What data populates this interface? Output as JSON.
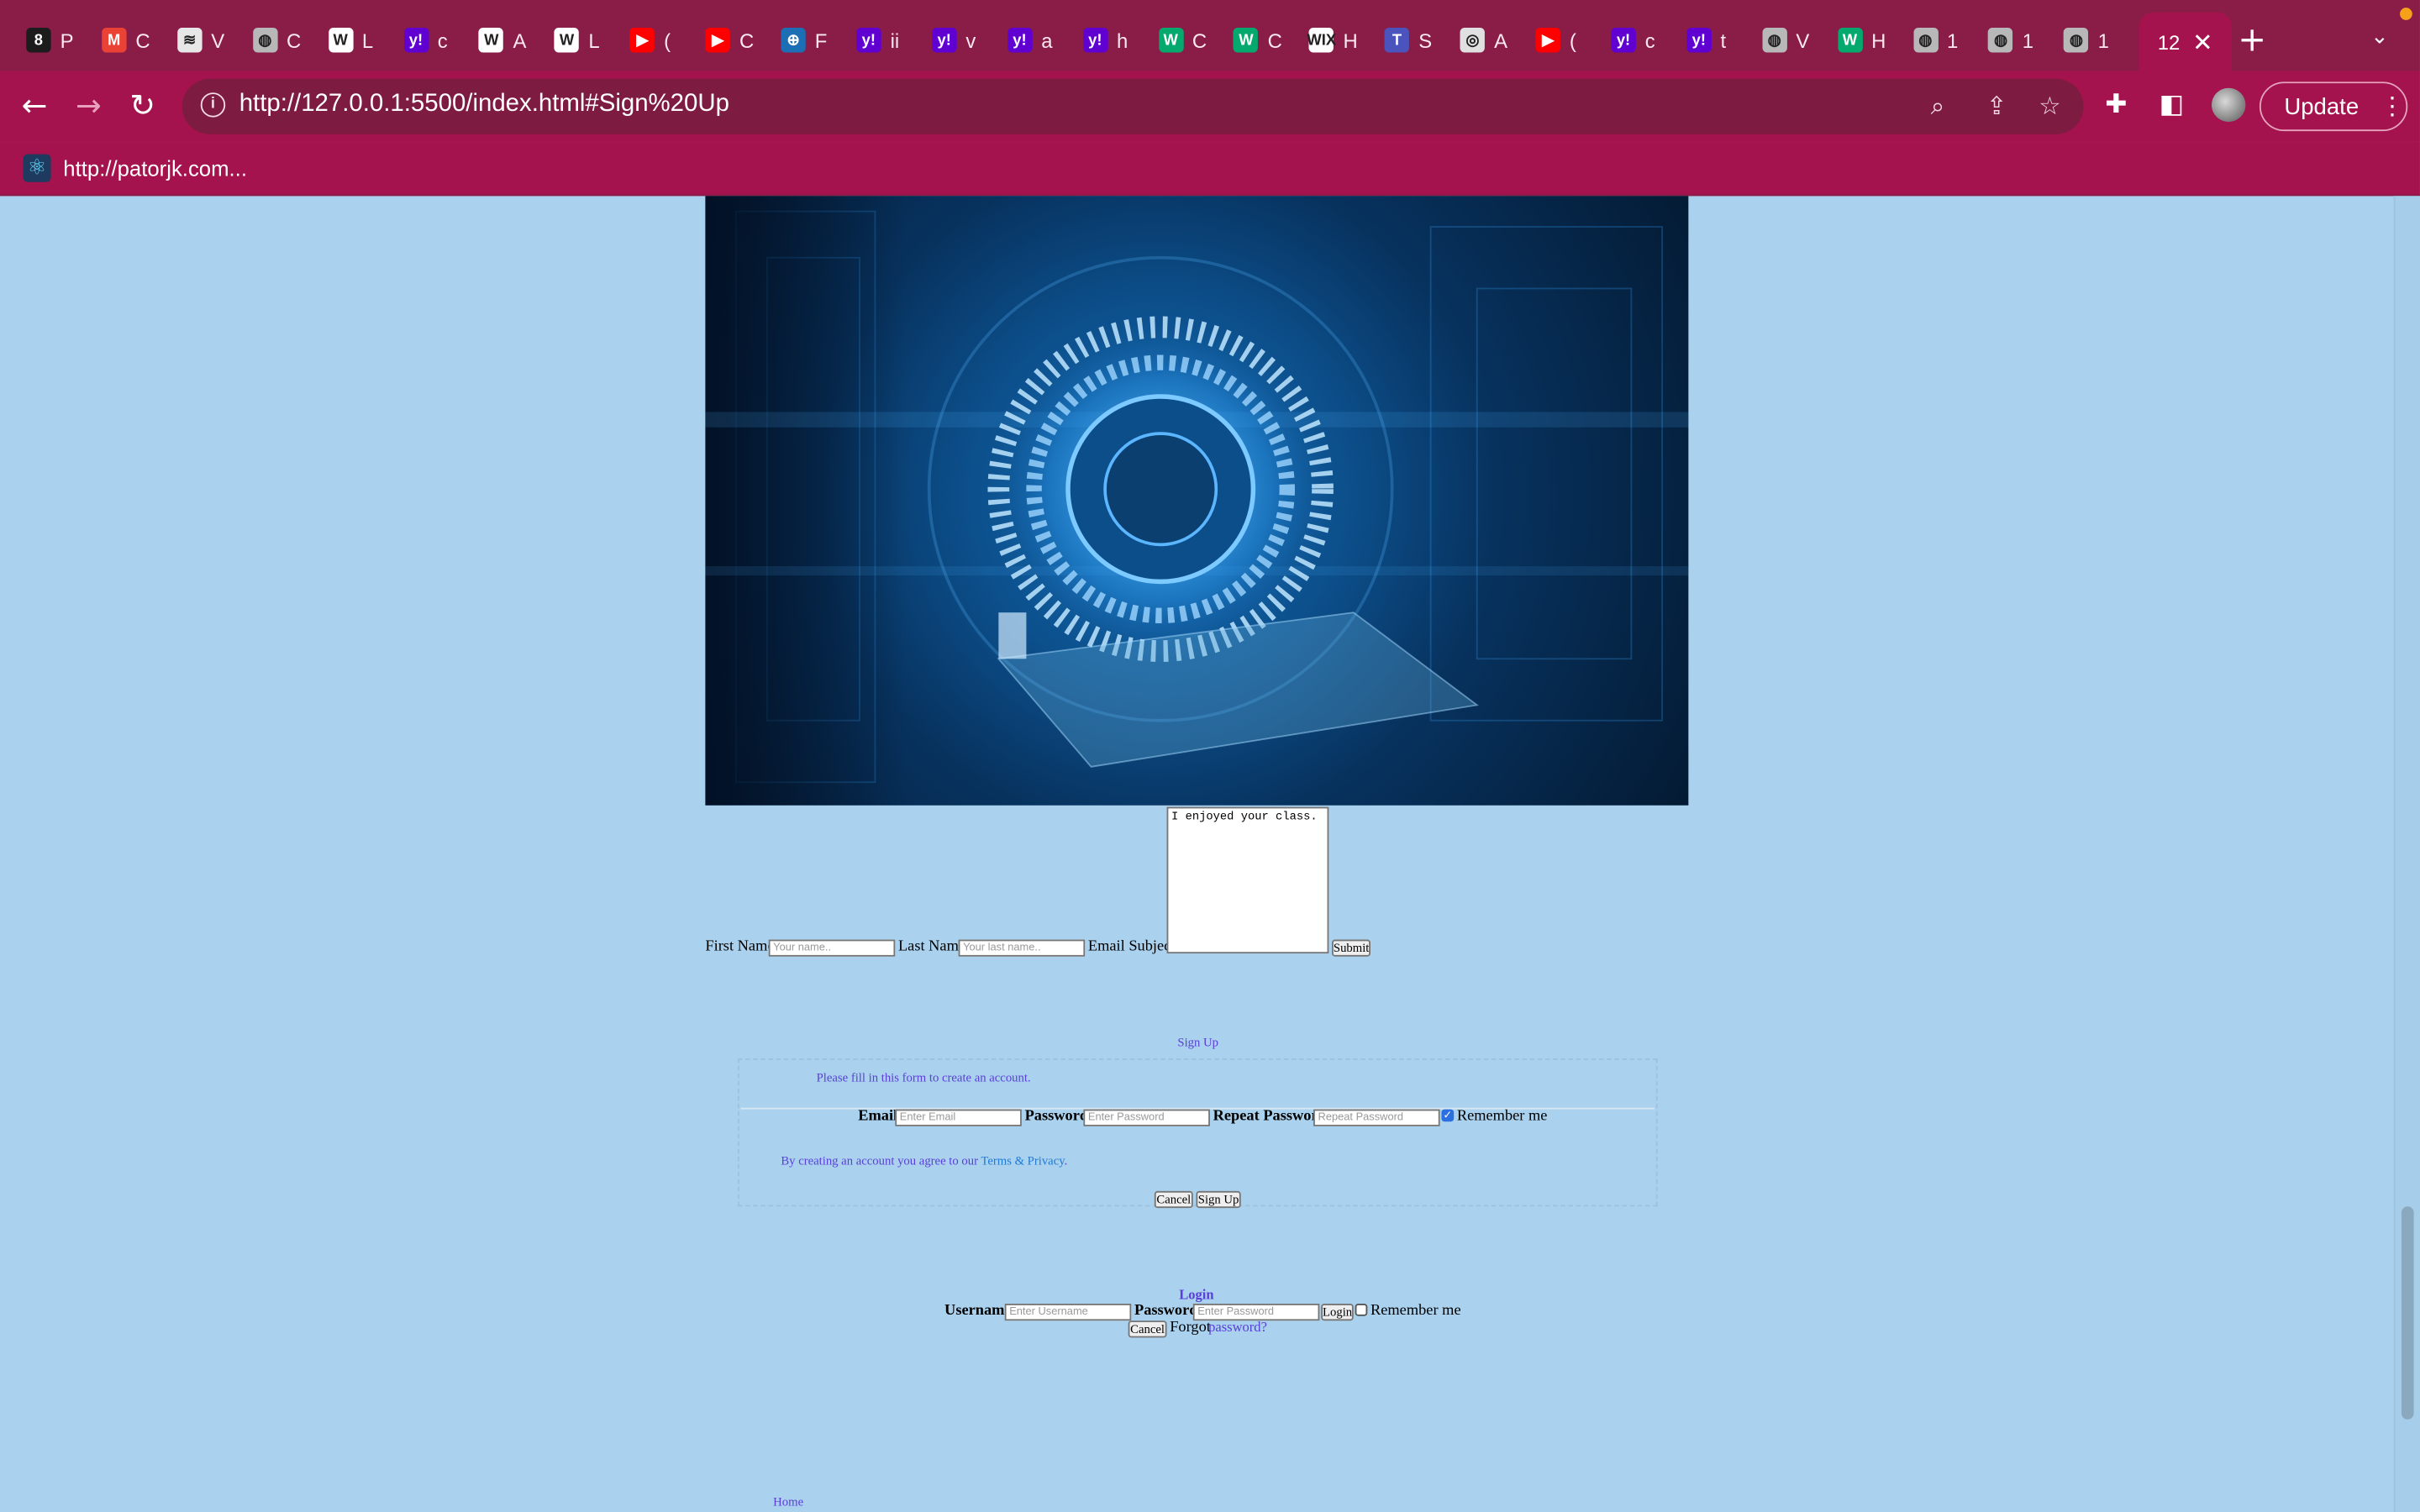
{
  "browser": {
    "tabs": [
      {
        "icon": "8",
        "label": "P",
        "color": "#1c1c1c"
      },
      {
        "icon": "M",
        "label": "C",
        "color": "#ea4335"
      },
      {
        "icon": "≋",
        "label": "V",
        "color": "#e7e7e7"
      },
      {
        "icon": "◍",
        "label": "C",
        "color": "#b8b8b8"
      },
      {
        "icon": "W",
        "label": "L",
        "color": "#ffffff"
      },
      {
        "icon": "y!",
        "label": "c",
        "color": "#6001d2"
      },
      {
        "icon": "W",
        "label": "A",
        "color": "#ffffff"
      },
      {
        "icon": "W",
        "label": "L",
        "color": "#ffffff"
      },
      {
        "icon": "▶",
        "label": "(",
        "color": "#ff0000"
      },
      {
        "icon": "▶",
        "label": "C",
        "color": "#ff0000"
      },
      {
        "icon": "⊕",
        "label": "F",
        "color": "#1c6fb5"
      },
      {
        "icon": "y!",
        "label": "ii",
        "color": "#6001d2"
      },
      {
        "icon": "y!",
        "label": "v",
        "color": "#6001d2"
      },
      {
        "icon": "y!",
        "label": "a",
        "color": "#6001d2"
      },
      {
        "icon": "y!",
        "label": "h",
        "color": "#6001d2"
      },
      {
        "icon": "W",
        "label": "C",
        "color": "#04aa6d"
      },
      {
        "icon": "W",
        "label": "C",
        "color": "#04aa6d"
      },
      {
        "icon": "WIX",
        "label": "H",
        "color": "#ffffff"
      },
      {
        "icon": "T",
        "label": "S",
        "color": "#4b53bc"
      },
      {
        "icon": "◎",
        "label": "A",
        "color": "#e0e0e0"
      },
      {
        "icon": "▶",
        "label": "(",
        "color": "#ff0000"
      },
      {
        "icon": "y!",
        "label": "c",
        "color": "#6001d2"
      },
      {
        "icon": "y!",
        "label": "t",
        "color": "#6001d2"
      },
      {
        "icon": "◍",
        "label": "V",
        "color": "#b8b8b8"
      },
      {
        "icon": "W",
        "label": "H",
        "color": "#04aa6d"
      },
      {
        "icon": "◍",
        "label": "1",
        "color": "#b8b8b8"
      },
      {
        "icon": "◍",
        "label": "1",
        "color": "#b8b8b8"
      },
      {
        "icon": "◍",
        "label": "1",
        "color": "#b8b8b8"
      }
    ],
    "active_tab_label": "12",
    "url": "http://127.0.0.1:5500/index.html#Sign%20Up",
    "update_label": "Update",
    "bookmark_label": "http://patorjk.com...",
    "chrome_color": "#a4134d"
  },
  "contact": {
    "first_name_label": "First Name",
    "first_name_placeholder": "Your name..",
    "last_name_label": "Last Name",
    "last_name_placeholder": "Your last name..",
    "email_subject_label": "Email Subject",
    "message_value": "I enjoyed your class.",
    "submit_label": "Submit"
  },
  "signup": {
    "title": "Sign Up",
    "subtitle": "Please fill in this form to create an account.",
    "email_label": "Email",
    "email_placeholder": "Enter Email",
    "password_label": "Password",
    "password_placeholder": "Enter Password",
    "repeat_label": "Repeat Password",
    "repeat_placeholder": "Repeat Password",
    "remember_label": "Remember me",
    "remember_checked": true,
    "terms_text": "By creating an account you agree to our",
    "terms_link": "Terms & Privacy",
    "terms_end": ".",
    "cancel_label": "Cancel",
    "submit_label": "Sign Up"
  },
  "login": {
    "title": "Login",
    "username_label": "Username",
    "username_placeholder": "Enter Username",
    "password_label": "Password",
    "password_placeholder": "Enter Password",
    "login_label": "Login",
    "remember_label": "Remember me",
    "remember_checked": false,
    "cancel_label": "Cancel",
    "forgot_text": "Forgot",
    "forgot_link": "password?"
  },
  "footer": {
    "home_link": "Home"
  },
  "page": {
    "background": "#aad1ee",
    "link_color": "#5a3fd8"
  }
}
